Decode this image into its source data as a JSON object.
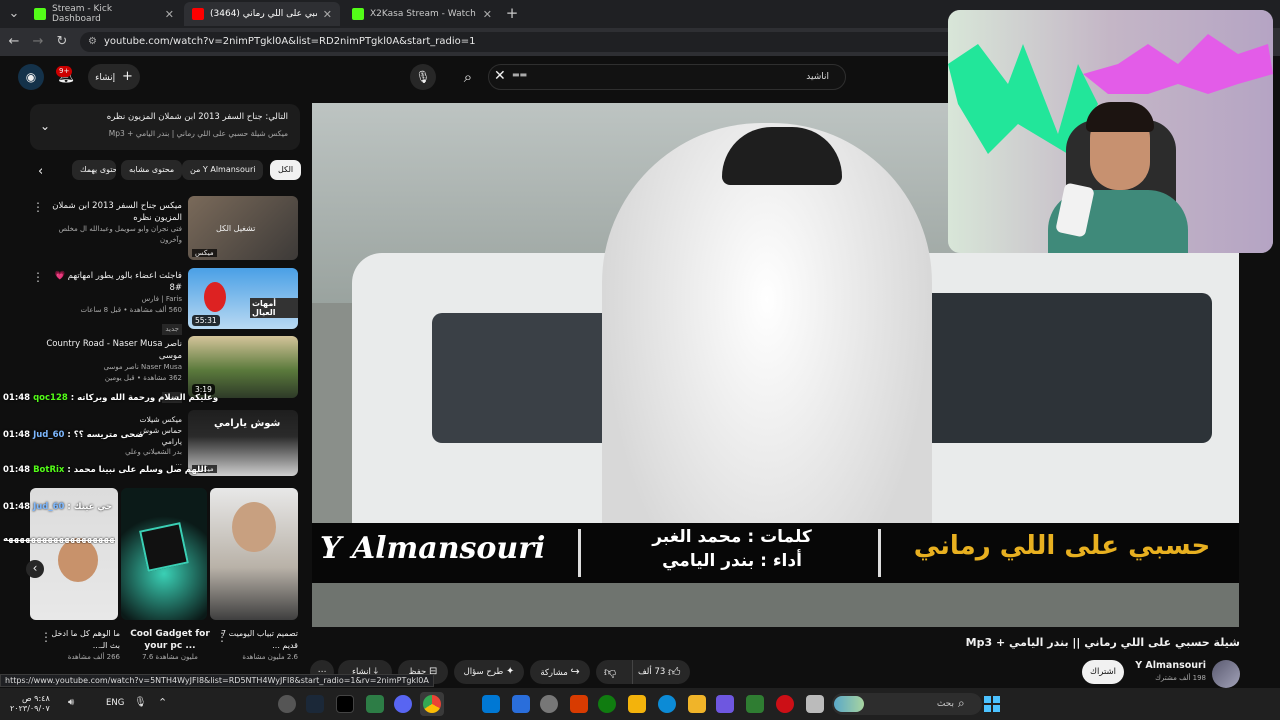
{
  "browser": {
    "tabs": [
      {
        "title": "Stream - Kick Dashboard",
        "active": false
      },
      {
        "title": "(3464) شيلة حسبي على اللي رماني",
        "active": true
      },
      {
        "title": "X2Kasa Stream - Watch Live on",
        "active": false
      }
    ],
    "url": "youtube.com/watch?v=2nimPTgkl0A&list=RD2nimPTgkl0A&start_radio=1",
    "status_url": "https://www.youtube.com/watch?v=5NTH4WyJFI8&list=RD5NTH4WyJFI8&start_radio=1&rv=2nimPTgkl0A"
  },
  "header": {
    "create_label": "إنشاء",
    "notif_badge": "9+",
    "search_text": "اناشيد",
    "search_chip": "▬▬"
  },
  "queue": {
    "next_title": "التالي: جناح السفر 2013 ابن شملان المزيون نظره",
    "subtitle": "ميكس شيلة حسبي على اللي رماني | بندر اليامي + Mp3"
  },
  "chips": [
    "الكل",
    "من Y Almansouri",
    "محتوى مشابه",
    "محتوى يهمك"
  ],
  "recommendations": [
    {
      "title": "ميكس جناح السفر 2013 ابن شملان المزيون نظره",
      "meta": "فتى نجران وابو سويمل وعبدالله ال مخلص وآخرون",
      "badge": "ميكس",
      "overlay": "تشغيل الكل"
    },
    {
      "title": "فاجئت اعضاء بالور يطور امهاتهم 💗 #8",
      "channel": "Faris | فارس",
      "meta": "560 ألف مشاهدة • قبل 8 ساعات",
      "badge": "جديد",
      "duration": "55:31",
      "thumb_text": "أمهات العيال"
    },
    {
      "title": "ناصر Country Road - Naser Musa موسى",
      "channel": "Naser Musa ناصر موسى",
      "meta": "362 مشاهدة • قبل يومين",
      "badge": "جديد",
      "duration": "3:19"
    },
    {
      "title": "ميكس شيلات حماس شوش يارامي",
      "meta": "بدر الشعيلاني وعلي ...",
      "badge": "ميكس",
      "thumb_text": "شوش يارامي"
    }
  ],
  "shorts": [
    {
      "title": "ما الوهم كل ما ادخل بث الـ...",
      "meta": "266 ألف مشاهدة"
    },
    {
      "title": "Cool Gadget for your pc ...",
      "meta": "7.6 مليون مشاهدة"
    },
    {
      "title": "تصميم تبياب اليوميت 7 قديم ...",
      "meta": "2.6 مليون مشاهدة"
    }
  ],
  "chat": [
    {
      "time": "01:48",
      "user": "qoc128",
      "msg": "وعليكم السلام ورحمة الله وبركاته"
    },
    {
      "time": "01:48",
      "user": "Jud_60",
      "msg": "ضحى متريسه ؟؟"
    },
    {
      "time": "01:48",
      "user": "BotRix",
      "msg": "اللهم صل وسلم على نبينا محمد"
    },
    {
      "time": "01:48",
      "user": "Jud_60",
      "msg": "حي عينك"
    },
    {
      "time": "",
      "user": "",
      "msg": "ههههههههههههههههههههههههههههههههه"
    }
  ],
  "video": {
    "banner_title": "حسبي على اللي رماني",
    "banner_words": "كلمات : محمد الغبر",
    "banner_perf": "أداء : بندر اليامي",
    "banner_channel": "Y Almansouri"
  },
  "meta": {
    "title": "شيلة حسبي على اللي رماني || بندر اليامي + Mp3",
    "channel": "Y Almansouri",
    "subs": "198 ألف مشترك",
    "subscribe_label": "اشتراك",
    "like_count": "73 ألف",
    "share_label": "مشاركة",
    "ask_label": "طرح سؤال",
    "save_label": "حفظ",
    "clip_label": "إنشاء"
  },
  "taskbar": {
    "search_placeholder": "بحث",
    "lang": "ENG",
    "time": "٩:٤٨ ص",
    "date": "٢٠٢٣/٠٩/٠٧"
  },
  "colors": {
    "kick_green": "#53fc18",
    "youtube_red": "#ff0000",
    "banner_gold": "#e8b020"
  }
}
